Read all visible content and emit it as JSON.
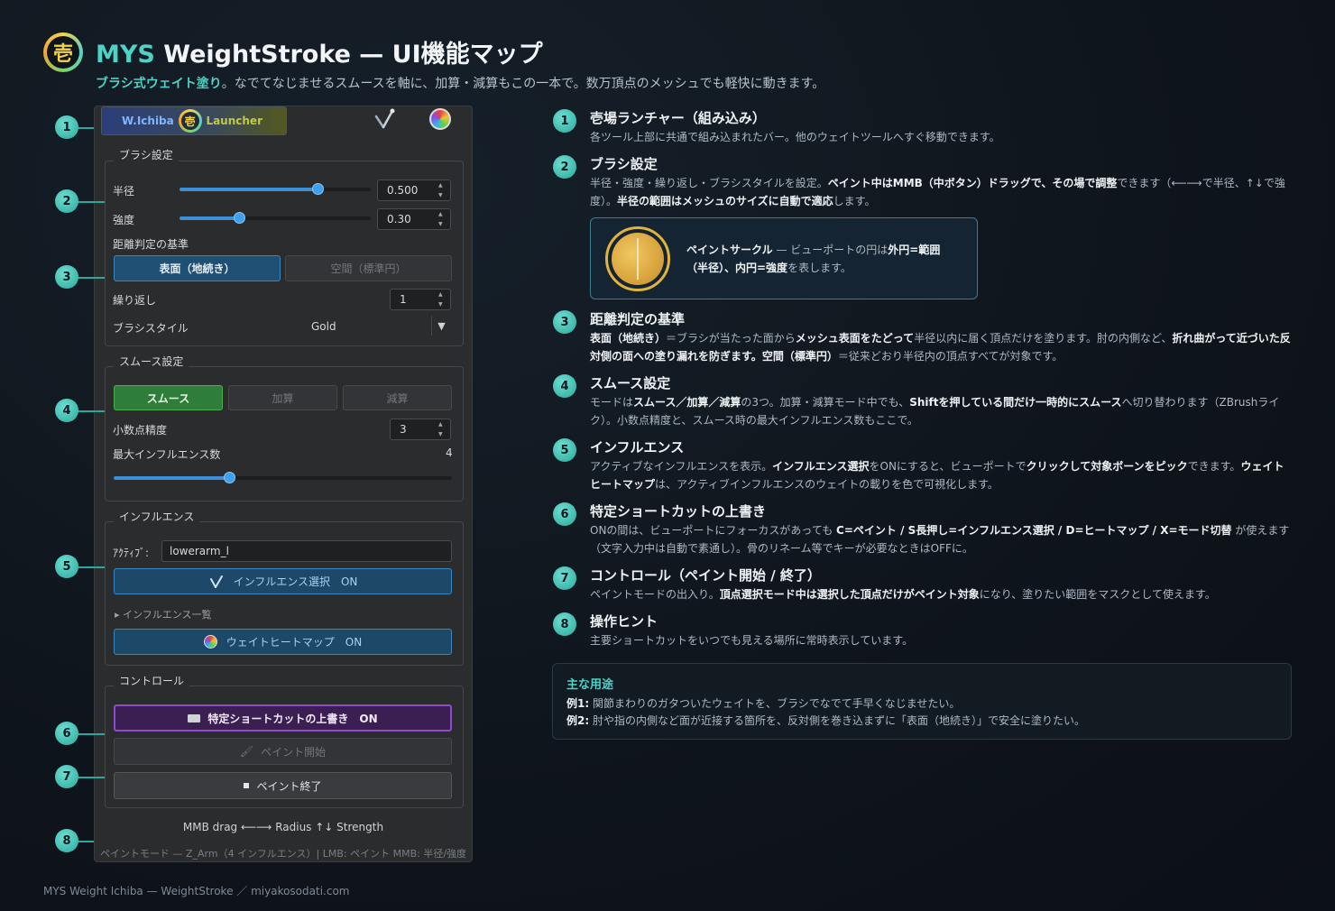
{
  "header": {
    "logo_glyph": "壱",
    "title_accent": "MYS",
    "title_rest": " WeightStroke — UI機能マップ",
    "subtitle_accent": "ブラシ式ウェイト塗り",
    "subtitle_rest": "。なでてなじませるスムースを軸に、加算・減算もこの一本で。数万頂点のメッシュでも軽快に動きます。"
  },
  "panel": {
    "launcher": {
      "left": "W.Ichiba",
      "glyph": "壱",
      "right": "Launcher"
    },
    "brush": {
      "title": "ブラシ設定",
      "radius_label": "半径",
      "radius_value": "0.500",
      "radius_fraction": 0.72,
      "strength_label": "強度",
      "strength_value": "0.30",
      "strength_fraction": 0.31,
      "distance_label": "距離判定の基準",
      "surface_btn": "表面（地続き）",
      "space_btn": "空間（標準円）",
      "repeat_label": "繰り返し",
      "repeat_value": "1",
      "style_label": "ブラシスタイル",
      "style_value": "Gold"
    },
    "smooth": {
      "title": "スムース設定",
      "modes": [
        "スムース",
        "加算",
        "減算"
      ],
      "decimal_label": "小数点精度",
      "decimal_value": "3",
      "max_inf_label": "最大インフルエンス数",
      "max_inf_value": "4",
      "max_inf_fraction": 0.34
    },
    "influence": {
      "title": "インフルエンス",
      "active_label": "ｱｸﾃｨﾌﾞ:",
      "active_value": "lowerarm_l",
      "pick_btn": "インフルエンス選択　ON",
      "list_label": "▸ インフルエンス一覧",
      "heatmap_btn": "ウェイトヒートマップ　ON"
    },
    "control": {
      "title": "コントロール",
      "shortcut_btn": "特定ショートカットの上書き　ON",
      "start_btn": "ペイント開始",
      "end_btn": "ペイント終了"
    },
    "hint": "MMB drag ⟵⟶ Radius  ↑↓ Strength",
    "status": "ペイントモード — Z_Arm（4 インフルエンス）| LMB: ペイント  MMB: 半径/強度"
  },
  "markers": [
    "1",
    "2",
    "3",
    "4",
    "5",
    "6",
    "7",
    "8"
  ],
  "sections": [
    {
      "num": "1",
      "title": "壱場ランチャー（組み込み）",
      "body": "各ツール上部に共通で組み込まれたバー。他のウェイトツールへすぐ移動できます。"
    },
    {
      "num": "2",
      "title": "ブラシ設定",
      "body_a": "半径・強度・繰り返し・ブラシスタイルを設定。",
      "body_b": "ペイント中はMMB（中ボタン）ドラッグで、その場で調整",
      "body_c": "できます（⟵⟶で半径、↑↓で強度）。",
      "body_d": "半径の範囲はメッシュのサイズに自動で適応",
      "body_e": "します。"
    },
    {
      "num": "3",
      "title": "距離判定の基準",
      "body_a": "表面（地続き）",
      "body_b": "＝ブラシが当たった面から",
      "body_c": "メッシュ表面をたどって",
      "body_d": "半径以内に届く頂点だけを塗ります。肘の内側など、",
      "body_e": "折れ曲がって近づいた反対側の面への塗り漏れを防ぎます。",
      "body_f": "空間（標準円）",
      "body_g": "＝従来どおり半径内の頂点すべてが対象です。"
    },
    {
      "num": "4",
      "title": "スムース設定",
      "body_a": "モードは",
      "body_b": "スムース／加算／減算",
      "body_c": "の3つ。加算・減算モード中でも、",
      "body_d": "Shiftを押している間だけ一時的にスムース",
      "body_e": "へ切り替わります（ZBrushライク）。小数点精度と、スムース時の最大インフルエンス数もここで。"
    },
    {
      "num": "5",
      "title": "インフルエンス",
      "body_a": "アクティブなインフルエンスを表示。",
      "body_b": "インフルエンス選択",
      "body_c": "をONにすると、ビューポートで",
      "body_d": "クリックして対象ボーンをピック",
      "body_e": "できます。",
      "body_f": "ウェイトヒートマップ",
      "body_g": "は、アクティブインフルエンスのウェイトの載りを色で可視化します。"
    },
    {
      "num": "6",
      "title": "特定ショートカットの上書き",
      "body_a": "ONの間は、ビューポートにフォーカスがあっても ",
      "body_b": "C=ペイント / S長押し=インフルエンス選択 / D=ヒートマップ / X=モード切替",
      "body_c": " が使えます（文字入力中は自動で素通し）。骨のリネーム等でキーが必要なときはOFFに。"
    },
    {
      "num": "7",
      "title": "コントロール（ペイント開始 / 終了）",
      "body_a": "ペイントモードの出入り。",
      "body_b": "頂点選択モード中は選択した頂点だけがペイント対象",
      "body_c": "になり、塗りたい範囲をマスクとして使えます。"
    },
    {
      "num": "8",
      "title": "操作ヒント",
      "body": "主要ショートカットをいつでも見える場所に常時表示しています。"
    }
  ],
  "callout": {
    "a": "ペイントサークル",
    "b": " — ビューポートの円は",
    "c": "外円=範囲（半径）、内円=強度",
    "d": "を表します。"
  },
  "uses": {
    "title": "主な用途",
    "ex1_label": "例1:",
    "ex1": " 関節まわりのガタついたウェイトを、ブラシでなでて手早くなじませたい。",
    "ex2_label": "例2:",
    "ex2": " 肘や指の内側など面が近接する箇所を、反対側を巻き込まずに「表面（地続き）」で安全に塗りたい。"
  },
  "footer": "MYS Weight Ichiba — WeightStroke ／ miyakosodati.com",
  "colors": {
    "accent": "#4fd1c5",
    "panel": "#2b2c2e",
    "slider": "#3a8fd6",
    "gold": "#e0b43a"
  }
}
